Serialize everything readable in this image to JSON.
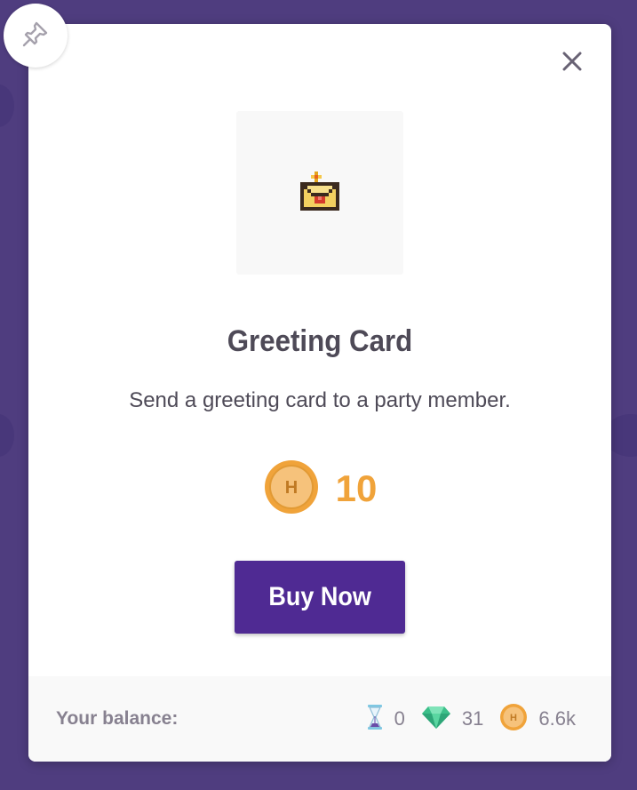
{
  "modal": {
    "title": "Greeting Card",
    "description": "Send a greeting card to a party member.",
    "price": "10",
    "buy_label": "Buy Now",
    "item_icon": "greeting-card-sprite"
  },
  "balance": {
    "label": "Your balance:",
    "hourglasses": "0",
    "gems": "31",
    "gold": "6.6k"
  },
  "colors": {
    "background": "#4f3d7f",
    "button": "#4f2a93",
    "price": "#f0a33a",
    "text": "#4e4a57",
    "muted": "#878190"
  }
}
